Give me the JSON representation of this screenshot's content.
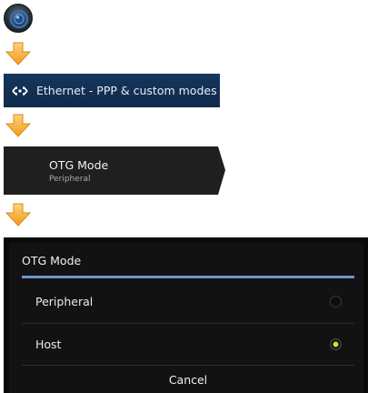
{
  "ethernet": {
    "label": "Ethernet - PPP & custom modes"
  },
  "otg_setting": {
    "title": "OTG Mode",
    "value": "Peripheral"
  },
  "dialog": {
    "title": "OTG Mode",
    "options": [
      {
        "label": "Peripheral",
        "selected": false
      },
      {
        "label": "Host",
        "selected": true
      }
    ],
    "cancel_label": "Cancel"
  },
  "colors": {
    "accent_rule": "#6f93d6",
    "radio_selected": "#c6e82a",
    "ethernet_bar": "#16365c",
    "arrow": "#f7a928"
  },
  "icons": [
    "settings-icon",
    "down-arrow-icon",
    "ethernet-icon",
    "radio-icon"
  ]
}
